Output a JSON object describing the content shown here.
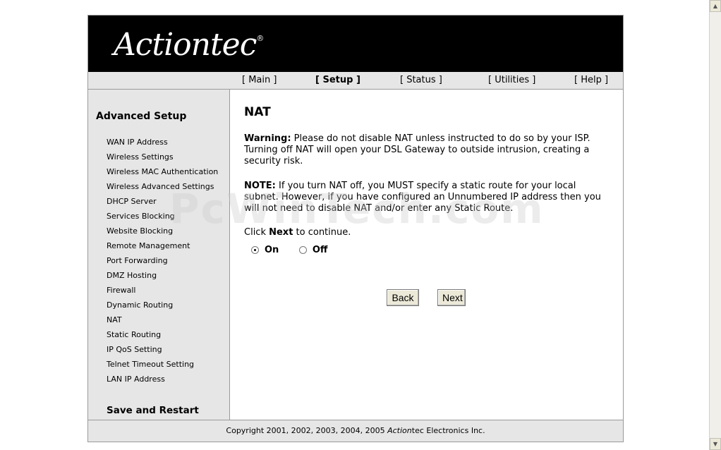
{
  "brand": {
    "logo_text": "Actiontec",
    "trademark": "®"
  },
  "topnav": [
    {
      "label": "[ Main ]"
    },
    {
      "label": "[ Setup ]",
      "active": true
    },
    {
      "label": "[ Status ]"
    },
    {
      "label": "[ Utilities ]"
    },
    {
      "label": "[ Help ]"
    }
  ],
  "sidebar": {
    "heading": "Advanced Setup",
    "items": [
      "WAN IP Address",
      "Wireless Settings",
      "Wireless MAC Authentication",
      "Wireless Advanced Settings",
      "DHCP Server",
      "Services Blocking",
      "Website Blocking",
      "Remote Management",
      "Port Forwarding",
      "DMZ Hosting",
      "Firewall",
      "Dynamic Routing",
      "NAT",
      "Static Routing",
      "IP QoS Setting",
      "Telnet Timeout Setting",
      "LAN IP Address"
    ],
    "save_restart": "Save and Restart"
  },
  "main": {
    "title": "NAT",
    "warning_label": "Warning:",
    "warning_text": " Please do not disable NAT unless instructed to do so by your ISP. Turning off NAT will open your DSL Gateway to outside intrusion, creating a security risk.",
    "note_label": "NOTE:",
    "note_text": " If you turn NAT off, you MUST specify a static route for your local subnet. However, if you have configured an Unnumbered IP address then you will not need to disable NAT and/or enter any Static Route.",
    "click_prefix": "Click ",
    "click_bold": "Next",
    "click_suffix": " to continue.",
    "radio_on": "On",
    "radio_off": "Off",
    "selected": "On",
    "back_button": "Back",
    "next_button": "Next"
  },
  "footer": {
    "prefix": "Copyright 2001, 2002, 2003, 2004, 2005 ",
    "brand": "Action",
    "suffix": "tec Electronics Inc."
  },
  "watermark": "PcWinTech.com"
}
